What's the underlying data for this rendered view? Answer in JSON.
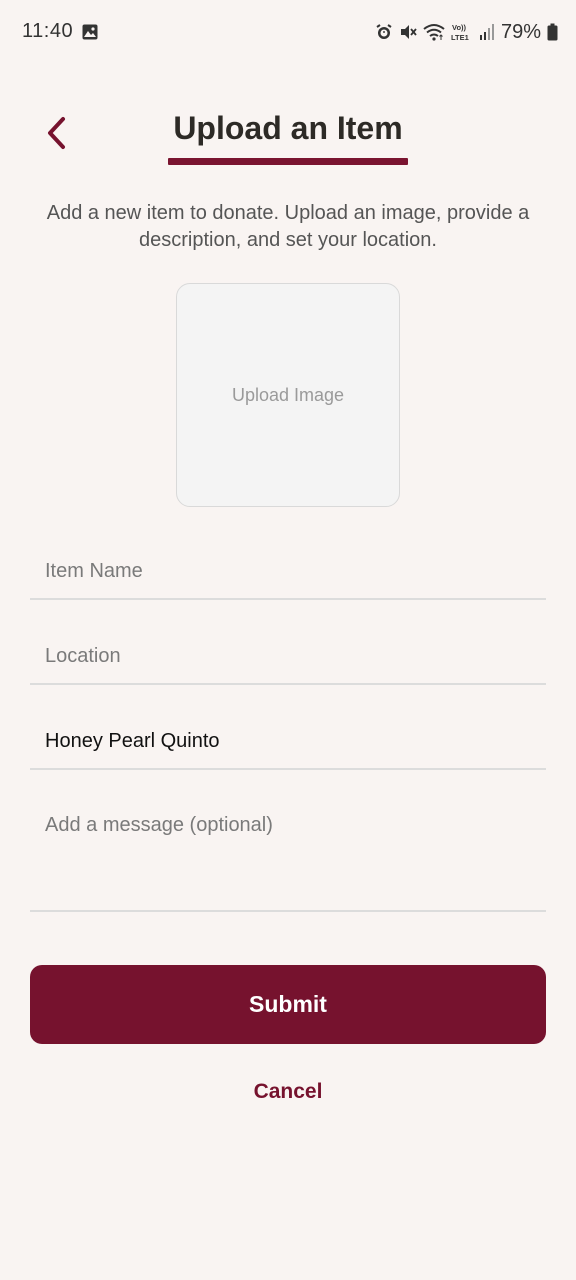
{
  "status_bar": {
    "time": "11:40",
    "battery": "79%",
    "icons": [
      "gallery-icon",
      "alarm-icon",
      "mute-icon",
      "wifi-icon",
      "volte-lte-icon",
      "signal-icon",
      "battery-icon"
    ]
  },
  "header": {
    "back_icon": "chevron-left-icon",
    "title": "Upload an Item",
    "subtitle": "Add a new item to donate. Upload an image, provide a description, and set your location."
  },
  "upload": {
    "label": "Upload Image"
  },
  "form": {
    "item_name": {
      "value": "",
      "placeholder": "Item Name"
    },
    "location": {
      "value": "",
      "placeholder": "Location"
    },
    "donor_name": {
      "value": "Honey Pearl Quinto",
      "placeholder": ""
    },
    "message": {
      "value": "",
      "placeholder": "Add a message (optional)"
    }
  },
  "actions": {
    "submit_label": "Submit",
    "cancel_label": "Cancel"
  },
  "colors": {
    "accent": "#76122e",
    "background": "#f9f4f2",
    "title_text": "#2d2a26",
    "placeholder_text": "#7a7a7a"
  }
}
